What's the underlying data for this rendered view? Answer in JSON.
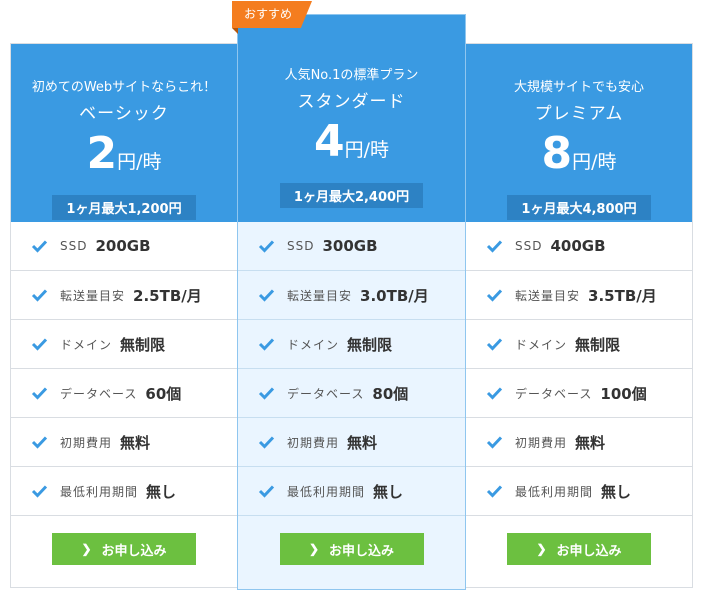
{
  "badge_label": "おすすめ",
  "colors": {
    "header": "#3a9ae2",
    "accent_badge": "#f47d1f",
    "button": "#6cc040"
  },
  "plans": [
    {
      "tagline": "初めてのWebサイトならこれ！",
      "name": "ベーシック",
      "price": "2",
      "price_unit": "円/時",
      "monthly_max": "1ヶ月最大1,200円",
      "features": [
        {
          "label": "SSD",
          "value": "200GB"
        },
        {
          "label": "転送量目安",
          "value": "2.5TB/月"
        },
        {
          "label": "ドメイン",
          "value": "無制限"
        },
        {
          "label": "データベース",
          "value": "60個"
        },
        {
          "label": "初期費用",
          "value": "無料"
        },
        {
          "label": "最低利用期間",
          "value": "無し"
        }
      ],
      "button_label": "お申し込み"
    },
    {
      "tagline": "人気No.1の標準プラン",
      "name": "スタンダード",
      "price": "4",
      "price_unit": "円/時",
      "monthly_max": "1ヶ月最大2,400円",
      "features": [
        {
          "label": "SSD",
          "value": "300GB"
        },
        {
          "label": "転送量目安",
          "value": "3.0TB/月"
        },
        {
          "label": "ドメイン",
          "value": "無制限"
        },
        {
          "label": "データベース",
          "value": "80個"
        },
        {
          "label": "初期費用",
          "value": "無料"
        },
        {
          "label": "最低利用期間",
          "value": "無し"
        }
      ],
      "button_label": "お申し込み"
    },
    {
      "tagline": "大規模サイトでも安心",
      "name": "プレミアム",
      "price": "8",
      "price_unit": "円/時",
      "monthly_max": "1ヶ月最大4,800円",
      "features": [
        {
          "label": "SSD",
          "value": "400GB"
        },
        {
          "label": "転送量目安",
          "value": "3.5TB/月"
        },
        {
          "label": "ドメイン",
          "value": "無制限"
        },
        {
          "label": "データベース",
          "value": "100個"
        },
        {
          "label": "初期費用",
          "value": "無料"
        },
        {
          "label": "最低利用期間",
          "value": "無し"
        }
      ],
      "button_label": "お申し込み"
    }
  ]
}
